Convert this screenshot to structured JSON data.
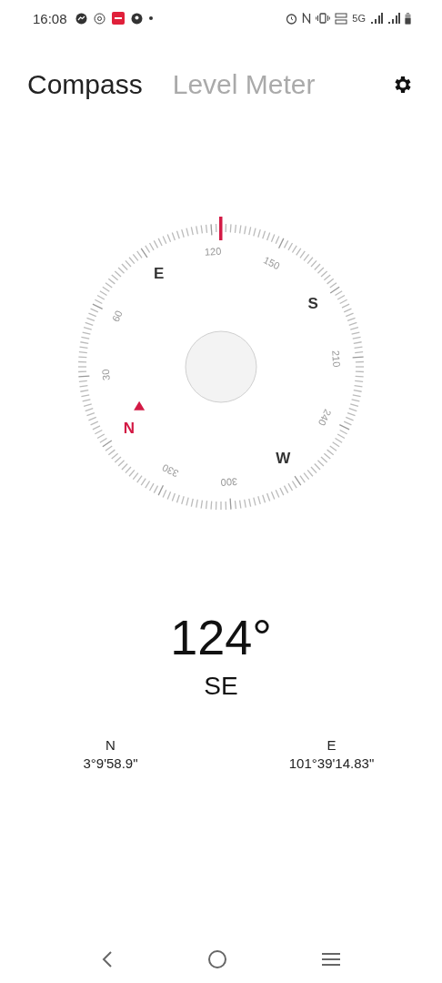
{
  "status_bar": {
    "time": "16:08",
    "network": "5G"
  },
  "tabs": [
    {
      "label": "Compass",
      "selected": true
    },
    {
      "label": "Level Meter",
      "selected": false
    }
  ],
  "compass": {
    "marks": [
      {
        "text": "N",
        "kind": "north"
      },
      {
        "text": "30",
        "kind": "degree"
      },
      {
        "text": "60",
        "kind": "degree"
      },
      {
        "text": "E",
        "kind": "cardinal"
      },
      {
        "text": "120",
        "kind": "degree"
      },
      {
        "text": "150",
        "kind": "degree"
      },
      {
        "text": "S",
        "kind": "cardinal"
      },
      {
        "text": "210",
        "kind": "degree"
      },
      {
        "text": "240",
        "kind": "degree"
      },
      {
        "text": "W",
        "kind": "cardinal"
      },
      {
        "text": "300",
        "kind": "degree"
      },
      {
        "text": "330",
        "kind": "degree"
      }
    ],
    "heading": "124°",
    "direction": "SE"
  },
  "coordinates": [
    {
      "label": "N",
      "value": "3°9'58.9\""
    },
    {
      "label": "E",
      "value": "101°39'14.83\""
    }
  ]
}
